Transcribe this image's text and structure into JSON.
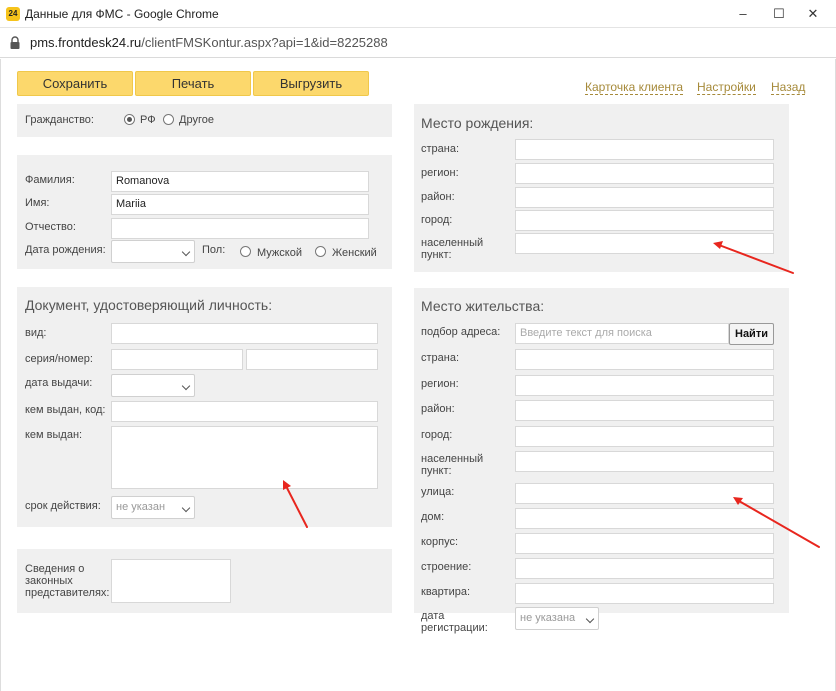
{
  "window": {
    "app_icon": "24",
    "title": "Данные для ФМС - Google Chrome",
    "controls": [
      "–",
      "☐",
      "✕"
    ]
  },
  "address_bar": {
    "host": "pms.frontdesk24.ru",
    "path": "/clientFMSKontur.aspx?api=1&id=8225288"
  },
  "toolbar": {
    "save": "Сохранить",
    "print": "Печать",
    "export": "Выгрузить"
  },
  "links": {
    "client_card": "Карточка клиента",
    "settings": "Настройки",
    "back": "Назад"
  },
  "citizenship": {
    "label": "Гражданство:",
    "options": [
      "РФ",
      "Другое"
    ],
    "selected": "РФ"
  },
  "person": {
    "surname_label": "Фамилия:",
    "surname": "Romanova",
    "name_label": "Имя:",
    "name": "Mariia",
    "patronymic_label": "Отчество:",
    "patronymic": "",
    "birthdate_label": "Дата рождения:",
    "gender_label": "Пол:",
    "gender_options": [
      "Мужской",
      "Женский"
    ]
  },
  "document": {
    "heading": "Документ, удостоверяющий личность:",
    "type_label": "вид:",
    "series_label": "серия/номер:",
    "issue_date_label": "дата выдачи:",
    "issued_by_code_label": "кем выдан, код:",
    "issued_by_label": "кем выдан:",
    "validity_label": "срок действия:",
    "validity_value": "не указан"
  },
  "representatives": {
    "label_line1": "Сведения о",
    "label_line2": "законных",
    "label_line3": "представителях:"
  },
  "birthplace": {
    "heading": "Место рождения:",
    "country": "страна:",
    "region": "регион:",
    "district": "район:",
    "city": "город:",
    "locality_line1": "населенный",
    "locality_line2": "пункт:"
  },
  "residence": {
    "heading": "Место жительства:",
    "address_search_label": "подбор адреса:",
    "search_placeholder": "Введите текст для поиска",
    "search_button": "Найти",
    "country": "страна:",
    "region": "регион:",
    "district": "район:",
    "city": "город:",
    "locality_line1": "населенный",
    "locality_line2": "пункт:",
    "street": "улица:",
    "house": "дом:",
    "building": "корпус:",
    "structure": "строение:",
    "apartment": "квартира:",
    "reg_date_line1": "дата",
    "reg_date_line2": "регистрации:",
    "reg_date_value": "не указана"
  },
  "colors": {
    "button_bg": "#fcd86c",
    "link": "#a68a3a",
    "panel": "#f0f0f0",
    "annotation_arrow": "#e8261e"
  }
}
